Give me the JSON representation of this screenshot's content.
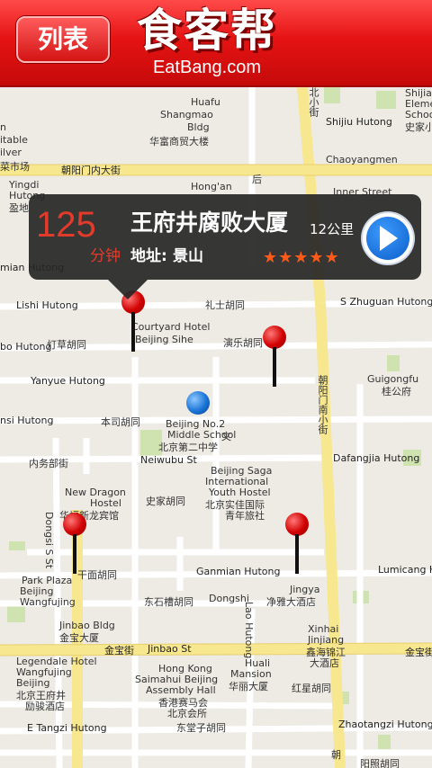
{
  "header": {
    "list_button": "列表",
    "logo_cn": "食客帮",
    "logo_en": "EatBang.com"
  },
  "bubble": {
    "minutes": "125",
    "minutes_unit": "分钟",
    "place_name": "王府井腐败大厦",
    "address_label": "地址:",
    "address_value": "景山",
    "distance": "12公里",
    "rating_stars": 5,
    "stars_text": "★★★★★"
  },
  "map_labels": {
    "huafu": "Huafu",
    "shangmao": "Shangmao",
    "bldg": "Bldg",
    "huafu_cn": "华富商贸大楼",
    "chaoyangmennei": "朝阳门内大街",
    "chaoyangmen": "Chaoyangmen",
    "inner_street": "Inner Street",
    "shijiu": "Shijiu Hutong",
    "shijia1": "Shijia",
    "shijia2": "Eleme",
    "shijia3": "Schoo",
    "shijia4": "史家小",
    "beixiao": "北小街",
    "hou": "后",
    "hongan": "Hong'an",
    "yingdi1": "Yingdi",
    "yingdi2": "Hutong",
    "yingdi3": "盈地",
    "n1": "n",
    "n2": "itable",
    "n3": "ilver",
    "n4": "菜市场",
    "lishi": "Lishi Hutong",
    "lishi_cn": "礼士胡同",
    "szhuguan": "S Zhuguan Hutong",
    "mian": "mian Hutong",
    "courtyard1": "Courtyard Hotel",
    "courtyard2": "Beijing Sihe",
    "dengcao": "灯草胡同",
    "bo": "bo Hutong",
    "yanle": "演乐胡同",
    "yanyue": "Yanyue Hutong",
    "guigong1": "Guigongfu",
    "guigong2": "桂公府",
    "chaoyangnan": "朝阳门南小街",
    "nsi": "nsi Hutong",
    "bensi": "本司胡同",
    "no2_1": "Beijing No.2",
    "no2_2": "Middle School",
    "no2_3": "北京第二中学",
    "wen": "文",
    "neiwubu_cn": "内务部街",
    "neiwubu": "Neiwubu St",
    "dafangjia": "Dafangjia Hutong",
    "saga1": "Beijing Saga",
    "saga2": "International",
    "saga3": "Youth Hostel",
    "saga4": "北京实佳国际",
    "saga5": "青年旅社",
    "nd1": "New Dragon",
    "nd2": "Hostel",
    "nd3": "华福新龙宾馆",
    "shijia_hu": "史家胡同",
    "dongsi": "Dongsi S St",
    "ganmian_cn": "干面胡同",
    "ganmian": "Ganmian Hutong",
    "lumicang": "Lumicang Hut",
    "pp1": "Park Plaza",
    "pp2": "Beijing",
    "pp3": "Wangfujing",
    "dongtang": "东石槽胡同",
    "dongshi": "Dongshi",
    "jingya1": "Jingya",
    "jingya2": "净雅大酒店",
    "xinhai1": "Xinhai",
    "xinhai2": "Jinjiang",
    "xinhai3": "鑫海锦江",
    "xinhai4": "大酒店",
    "jinbao1": "Jinbao Bldg",
    "jinbao2": "金宝大厦",
    "jinbaost_cn": "金宝街",
    "jinbaost": "Jinbao St",
    "jinbaost_cn2": "金宝街",
    "lao": "Lao Hutong",
    "leg1": "Legendale Hotel",
    "leg2": "Wangfujing",
    "leg3": "Beijing",
    "leg4": "北京王府井",
    "leg5": "励骏酒店",
    "hk1": "Hong Kong",
    "hk2": "Saimahui Beijing",
    "hk3": "Assembly Hall",
    "hk4": "香港赛马会",
    "hk5": "北京会所",
    "huali1": "Huali",
    "huali2": "Mansion",
    "huali3": "华丽大厦",
    "hongxing": "红星胡同",
    "etangzi": "E Tangzi Hutong",
    "dongtangzi": "东堂子胡同",
    "zhaotangzi": "Zhaotangzi Hutong",
    "yangzhao": "阳照胡同",
    "chao2": "朝"
  }
}
